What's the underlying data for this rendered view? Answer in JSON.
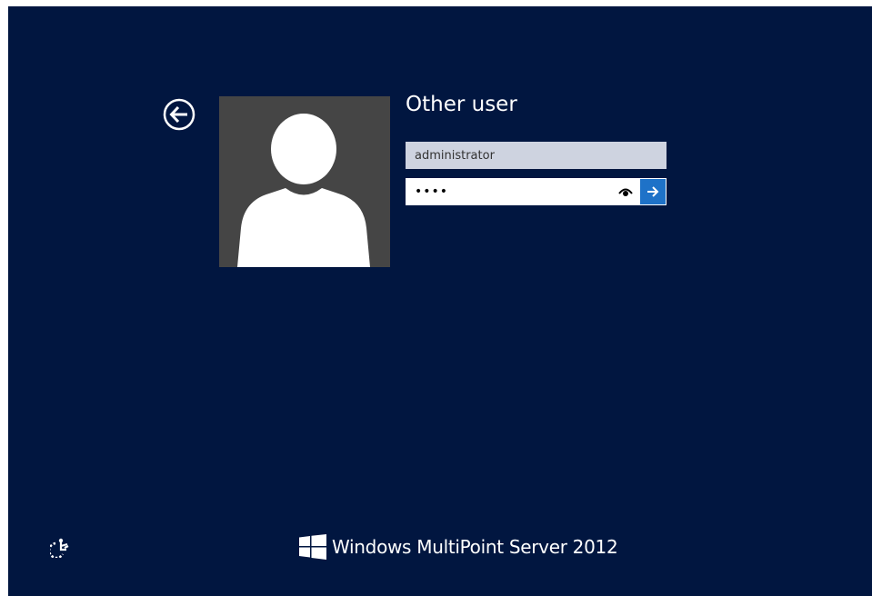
{
  "login": {
    "title": "Other user",
    "username_value": "administrator",
    "password_value": "••••",
    "back_icon": "back-arrow-circle-icon",
    "reveal_icon": "eye-icon",
    "submit_icon": "arrow-right-icon",
    "avatar_icon": "user-silhouette-icon"
  },
  "footer": {
    "ease_of_access_icon": "ease-of-access-icon",
    "brand_logo": "windows-logo-icon",
    "brand_text": "Windows MultiPoint Server 2012"
  },
  "colors": {
    "background": "#011640",
    "avatar_bg": "#454545",
    "username_field": "#ced3e0",
    "submit_accent": "#1e72c8"
  }
}
